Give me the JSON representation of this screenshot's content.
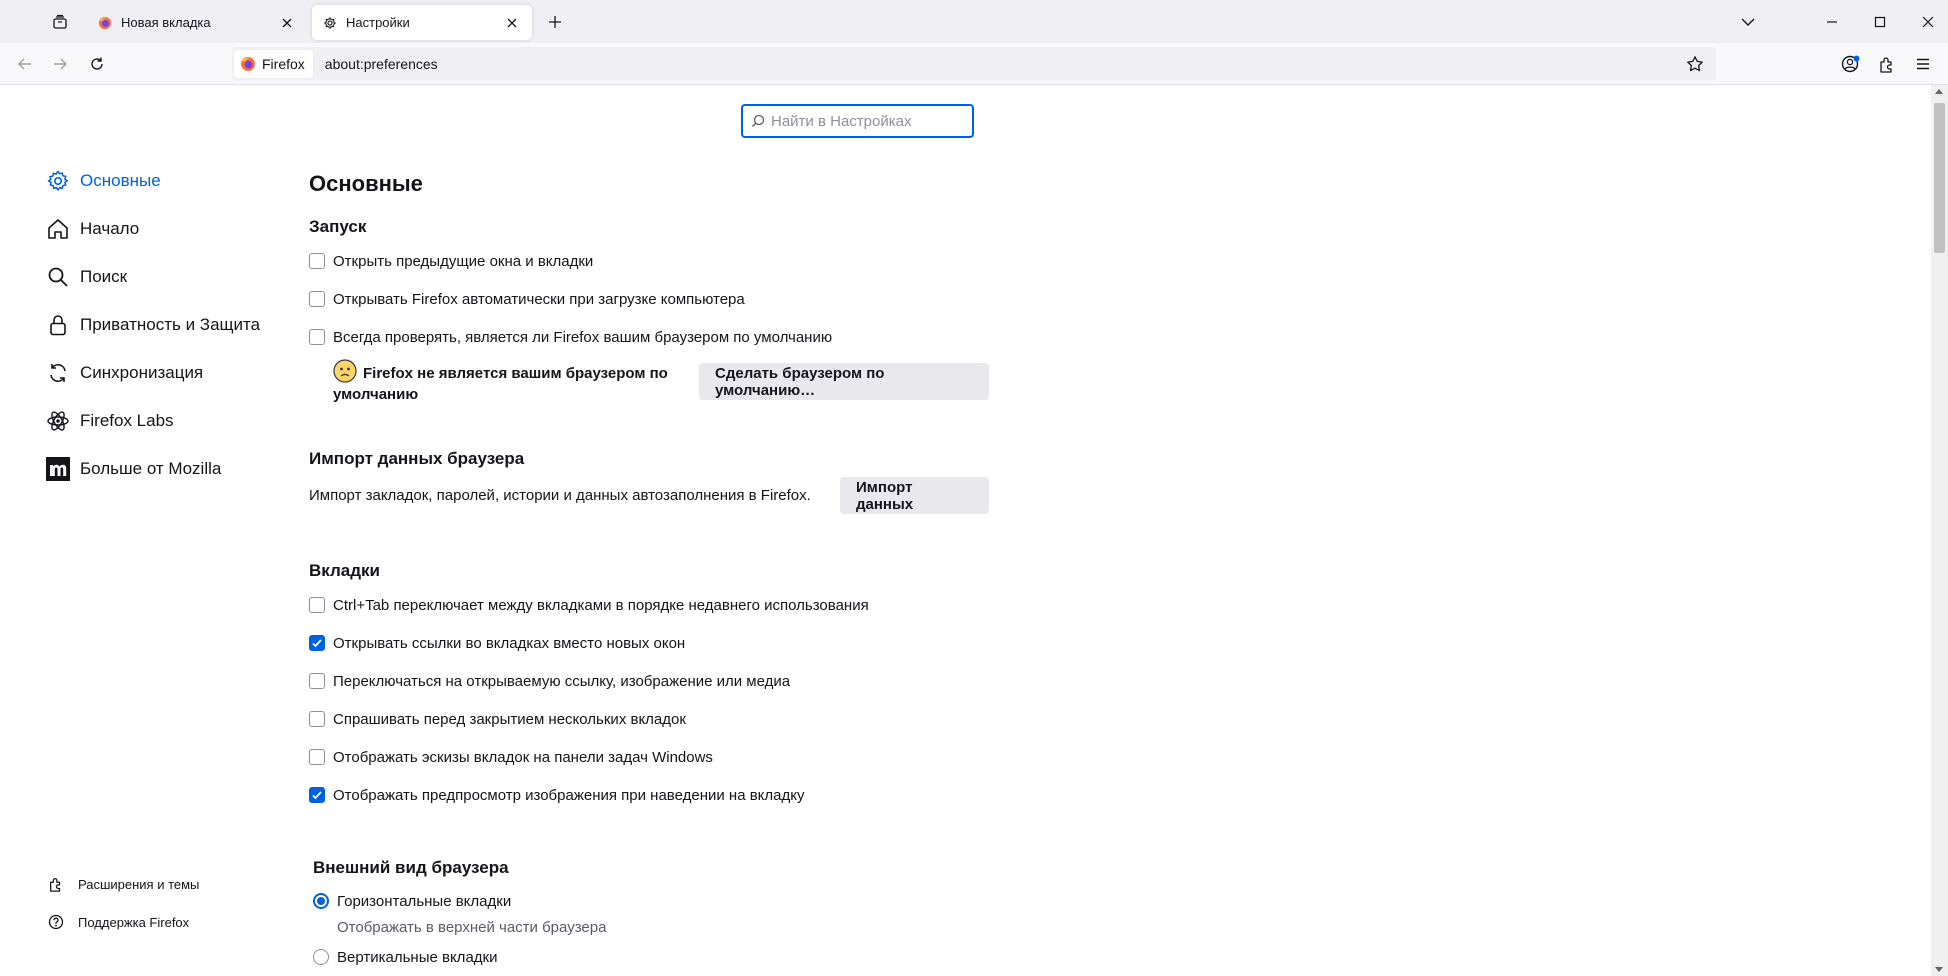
{
  "tabs": [
    {
      "title": "Новая вкладка",
      "icon": "firefox-icon"
    },
    {
      "title": "Настройки",
      "icon": "gear-icon",
      "active": true
    }
  ],
  "identity": {
    "label": "Firefox"
  },
  "url": "about:preferences",
  "search": {
    "placeholder": "Найти в Настройках"
  },
  "sidebar": {
    "items": [
      {
        "label": "Основные",
        "icon": "gear-icon",
        "active": true
      },
      {
        "label": "Начало",
        "icon": "home-icon"
      },
      {
        "label": "Поиск",
        "icon": "search-icon"
      },
      {
        "label": "Приватность и Защита",
        "icon": "lock-icon"
      },
      {
        "label": "Синхронизация",
        "icon": "sync-icon"
      },
      {
        "label": "Firefox Labs",
        "icon": "labs-icon"
      },
      {
        "label": "Больше от Mozilla",
        "icon": "mozilla-icon"
      }
    ],
    "footer": [
      {
        "label": "Расширения и темы",
        "icon": "puzzle-icon"
      },
      {
        "label": "Поддержка Firefox",
        "icon": "help-icon"
      }
    ]
  },
  "main": {
    "title": "Основные",
    "startup": {
      "heading": "Запуск",
      "options": [
        {
          "label": "Открыть предыдущие окна и вкладки",
          "checked": false
        },
        {
          "label": "Открывать Firefox автоматически при загрузке компьютера",
          "checked": false
        },
        {
          "label": "Всегда проверять, является ли Firefox вашим браузером по умолчанию",
          "checked": false
        }
      ],
      "default_note": "Firefox не является вашим браузером по умолчанию",
      "default_button": "Сделать браузером по умолчанию…"
    },
    "import": {
      "heading": "Импорт данных браузера",
      "description": "Импорт закладок, паролей, истории и данных автозаполнения в Firefox.",
      "button": "Импорт данных"
    },
    "tabs": {
      "heading": "Вкладки",
      "options": [
        {
          "label": "Ctrl+Tab переключает между вкладками в порядке недавнего использования",
          "checked": false
        },
        {
          "label": "Открывать ссылки во вкладках вместо новых окон",
          "checked": true
        },
        {
          "label": "Переключаться на открываемую ссылку, изображение или медиа",
          "checked": false
        },
        {
          "label": "Спрашивать перед закрытием нескольких вкладок",
          "checked": false
        },
        {
          "label": "Отображать эскизы вкладок на панели задач Windows",
          "checked": false
        },
        {
          "label": "Отображать предпросмотр изображения при наведении на вкладку",
          "checked": true
        }
      ]
    },
    "appearance": {
      "heading": "Внешний вид браузера",
      "options": [
        {
          "label": "Горизонтальные вкладки",
          "selected": true,
          "description": "Отображать в верхней части браузера"
        },
        {
          "label": "Вертикальные вкладки",
          "selected": false
        }
      ]
    }
  },
  "colors": {
    "accent": "#0061e0",
    "chrome": "#f0f0f4"
  }
}
